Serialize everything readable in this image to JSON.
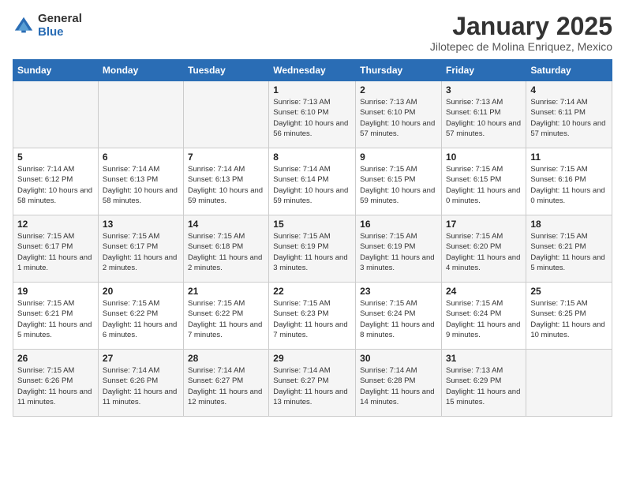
{
  "header": {
    "logo_line1": "General",
    "logo_line2": "Blue",
    "month_title": "January 2025",
    "location": "Jilotepec de Molina Enriquez, Mexico"
  },
  "weekdays": [
    "Sunday",
    "Monday",
    "Tuesday",
    "Wednesday",
    "Thursday",
    "Friday",
    "Saturday"
  ],
  "weeks": [
    [
      {
        "day": "",
        "sunrise": "",
        "sunset": "",
        "daylight": ""
      },
      {
        "day": "",
        "sunrise": "",
        "sunset": "",
        "daylight": ""
      },
      {
        "day": "",
        "sunrise": "",
        "sunset": "",
        "daylight": ""
      },
      {
        "day": "1",
        "sunrise": "Sunrise: 7:13 AM",
        "sunset": "Sunset: 6:10 PM",
        "daylight": "Daylight: 10 hours and 56 minutes."
      },
      {
        "day": "2",
        "sunrise": "Sunrise: 7:13 AM",
        "sunset": "Sunset: 6:10 PM",
        "daylight": "Daylight: 10 hours and 57 minutes."
      },
      {
        "day": "3",
        "sunrise": "Sunrise: 7:13 AM",
        "sunset": "Sunset: 6:11 PM",
        "daylight": "Daylight: 10 hours and 57 minutes."
      },
      {
        "day": "4",
        "sunrise": "Sunrise: 7:14 AM",
        "sunset": "Sunset: 6:11 PM",
        "daylight": "Daylight: 10 hours and 57 minutes."
      }
    ],
    [
      {
        "day": "5",
        "sunrise": "Sunrise: 7:14 AM",
        "sunset": "Sunset: 6:12 PM",
        "daylight": "Daylight: 10 hours and 58 minutes."
      },
      {
        "day": "6",
        "sunrise": "Sunrise: 7:14 AM",
        "sunset": "Sunset: 6:13 PM",
        "daylight": "Daylight: 10 hours and 58 minutes."
      },
      {
        "day": "7",
        "sunrise": "Sunrise: 7:14 AM",
        "sunset": "Sunset: 6:13 PM",
        "daylight": "Daylight: 10 hours and 59 minutes."
      },
      {
        "day": "8",
        "sunrise": "Sunrise: 7:14 AM",
        "sunset": "Sunset: 6:14 PM",
        "daylight": "Daylight: 10 hours and 59 minutes."
      },
      {
        "day": "9",
        "sunrise": "Sunrise: 7:15 AM",
        "sunset": "Sunset: 6:15 PM",
        "daylight": "Daylight: 10 hours and 59 minutes."
      },
      {
        "day": "10",
        "sunrise": "Sunrise: 7:15 AM",
        "sunset": "Sunset: 6:15 PM",
        "daylight": "Daylight: 11 hours and 0 minutes."
      },
      {
        "day": "11",
        "sunrise": "Sunrise: 7:15 AM",
        "sunset": "Sunset: 6:16 PM",
        "daylight": "Daylight: 11 hours and 0 minutes."
      }
    ],
    [
      {
        "day": "12",
        "sunrise": "Sunrise: 7:15 AM",
        "sunset": "Sunset: 6:17 PM",
        "daylight": "Daylight: 11 hours and 1 minute."
      },
      {
        "day": "13",
        "sunrise": "Sunrise: 7:15 AM",
        "sunset": "Sunset: 6:17 PM",
        "daylight": "Daylight: 11 hours and 2 minutes."
      },
      {
        "day": "14",
        "sunrise": "Sunrise: 7:15 AM",
        "sunset": "Sunset: 6:18 PM",
        "daylight": "Daylight: 11 hours and 2 minutes."
      },
      {
        "day": "15",
        "sunrise": "Sunrise: 7:15 AM",
        "sunset": "Sunset: 6:19 PM",
        "daylight": "Daylight: 11 hours and 3 minutes."
      },
      {
        "day": "16",
        "sunrise": "Sunrise: 7:15 AM",
        "sunset": "Sunset: 6:19 PM",
        "daylight": "Daylight: 11 hours and 3 minutes."
      },
      {
        "day": "17",
        "sunrise": "Sunrise: 7:15 AM",
        "sunset": "Sunset: 6:20 PM",
        "daylight": "Daylight: 11 hours and 4 minutes."
      },
      {
        "day": "18",
        "sunrise": "Sunrise: 7:15 AM",
        "sunset": "Sunset: 6:21 PM",
        "daylight": "Daylight: 11 hours and 5 minutes."
      }
    ],
    [
      {
        "day": "19",
        "sunrise": "Sunrise: 7:15 AM",
        "sunset": "Sunset: 6:21 PM",
        "daylight": "Daylight: 11 hours and 5 minutes."
      },
      {
        "day": "20",
        "sunrise": "Sunrise: 7:15 AM",
        "sunset": "Sunset: 6:22 PM",
        "daylight": "Daylight: 11 hours and 6 minutes."
      },
      {
        "day": "21",
        "sunrise": "Sunrise: 7:15 AM",
        "sunset": "Sunset: 6:22 PM",
        "daylight": "Daylight: 11 hours and 7 minutes."
      },
      {
        "day": "22",
        "sunrise": "Sunrise: 7:15 AM",
        "sunset": "Sunset: 6:23 PM",
        "daylight": "Daylight: 11 hours and 7 minutes."
      },
      {
        "day": "23",
        "sunrise": "Sunrise: 7:15 AM",
        "sunset": "Sunset: 6:24 PM",
        "daylight": "Daylight: 11 hours and 8 minutes."
      },
      {
        "day": "24",
        "sunrise": "Sunrise: 7:15 AM",
        "sunset": "Sunset: 6:24 PM",
        "daylight": "Daylight: 11 hours and 9 minutes."
      },
      {
        "day": "25",
        "sunrise": "Sunrise: 7:15 AM",
        "sunset": "Sunset: 6:25 PM",
        "daylight": "Daylight: 11 hours and 10 minutes."
      }
    ],
    [
      {
        "day": "26",
        "sunrise": "Sunrise: 7:15 AM",
        "sunset": "Sunset: 6:26 PM",
        "daylight": "Daylight: 11 hours and 11 minutes."
      },
      {
        "day": "27",
        "sunrise": "Sunrise: 7:14 AM",
        "sunset": "Sunset: 6:26 PM",
        "daylight": "Daylight: 11 hours and 11 minutes."
      },
      {
        "day": "28",
        "sunrise": "Sunrise: 7:14 AM",
        "sunset": "Sunset: 6:27 PM",
        "daylight": "Daylight: 11 hours and 12 minutes."
      },
      {
        "day": "29",
        "sunrise": "Sunrise: 7:14 AM",
        "sunset": "Sunset: 6:27 PM",
        "daylight": "Daylight: 11 hours and 13 minutes."
      },
      {
        "day": "30",
        "sunrise": "Sunrise: 7:14 AM",
        "sunset": "Sunset: 6:28 PM",
        "daylight": "Daylight: 11 hours and 14 minutes."
      },
      {
        "day": "31",
        "sunrise": "Sunrise: 7:13 AM",
        "sunset": "Sunset: 6:29 PM",
        "daylight": "Daylight: 11 hours and 15 minutes."
      },
      {
        "day": "",
        "sunrise": "",
        "sunset": "",
        "daylight": ""
      }
    ]
  ]
}
